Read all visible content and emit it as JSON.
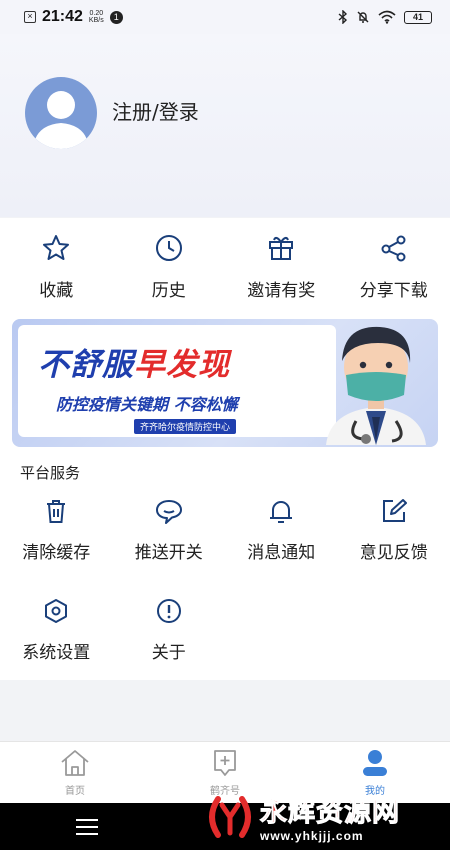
{
  "status_bar": {
    "time": "21:42",
    "speed_top": "0.20",
    "speed_bottom": "KB/s",
    "notification_count": "1",
    "battery": "41"
  },
  "profile": {
    "login_label": "注册/登录"
  },
  "quick_actions": [
    {
      "label": "收藏",
      "icon": "star-icon"
    },
    {
      "label": "历史",
      "icon": "clock-icon"
    },
    {
      "label": "邀请有奖",
      "icon": "gift-icon"
    },
    {
      "label": "分享下载",
      "icon": "share-icon"
    }
  ],
  "banner": {
    "title_part1": "不舒服",
    "title_part2": "早发现",
    "subtitle": "防控疫情关键期 不容松懈",
    "tag": "齐齐哈尔疫情防控中心"
  },
  "services": {
    "title": "平台服务",
    "items": [
      {
        "label": "清除缓存",
        "icon": "trash-icon"
      },
      {
        "label": "推送开关",
        "icon": "chat-bubble-icon"
      },
      {
        "label": "消息通知",
        "icon": "bell-icon"
      },
      {
        "label": "意见反馈",
        "icon": "edit-icon"
      },
      {
        "label": "系统设置",
        "icon": "settings-icon"
      },
      {
        "label": "关于",
        "icon": "info-icon"
      }
    ]
  },
  "tabbar": {
    "tabs": [
      {
        "label": "首页",
        "icon": "home-icon",
        "active": false
      },
      {
        "label": "鹤齐号",
        "icon": "add-post-icon",
        "active": false
      },
      {
        "label": "我的",
        "icon": "user-icon",
        "active": true
      }
    ]
  },
  "watermark": {
    "main": "永辉资源网",
    "url": "www.yhkjjj.com"
  },
  "colors": {
    "accent": "#3a7fd6",
    "icon_blue": "#1a3f7a",
    "banner_red": "#e32c2c",
    "banner_blue": "#1f3fae"
  }
}
